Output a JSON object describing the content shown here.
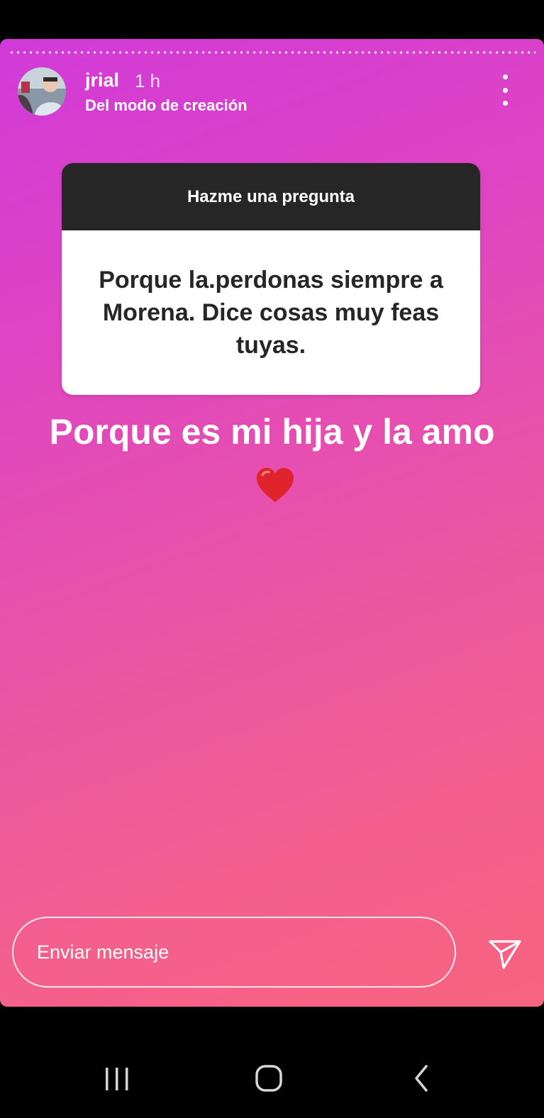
{
  "story": {
    "username": "jrial",
    "time_ago": "1 h",
    "subtitle": "Del modo de creación"
  },
  "question_sticker": {
    "header": "Hazme una pregunta",
    "question": "Porque la.perdonas siempre a Morena. Dice cosas muy feas tuyas."
  },
  "answer": {
    "text": "Porque es mi hija y la amo"
  },
  "reply": {
    "placeholder": "Enviar mensaje"
  },
  "icons": {
    "more": "more-vertical-icon",
    "send": "send-icon",
    "heart": "red-heart-emoji",
    "nav_recents": "recents-icon",
    "nav_home": "home-icon",
    "nav_back": "back-icon"
  },
  "colors": {
    "gradient_start": "#d13ad8",
    "gradient_end": "#f6647e",
    "sticker_header": "#262626",
    "heart": "#e0242b"
  }
}
